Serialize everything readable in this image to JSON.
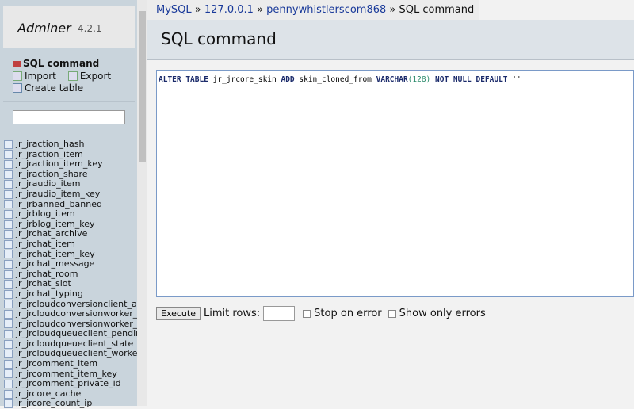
{
  "app": {
    "name": "Adminer",
    "version": "4.2.1"
  },
  "sidebar": {
    "menu": [
      {
        "label": "SQL command",
        "icon": "sql-icon"
      },
      {
        "label": "Import",
        "icon": "import-icon"
      },
      {
        "label": "Export",
        "icon": "export-icon"
      },
      {
        "label": "Create table",
        "icon": "create-table-icon"
      }
    ],
    "search_value": "",
    "tables": [
      "jr_jraction_hash",
      "jr_jraction_item",
      "jr_jraction_item_key",
      "jr_jraction_share",
      "jr_jraudio_item",
      "jr_jraudio_item_key",
      "jr_jrbanned_banned",
      "jr_jrblog_item",
      "jr_jrblog_item_key",
      "jr_jrchat_archive",
      "jr_jrchat_item",
      "jr_jrchat_item_key",
      "jr_jrchat_message",
      "jr_jrchat_room",
      "jr_jrchat_slot",
      "jr_jrchat_typing",
      "jr_jrcloudconversionclient_ac",
      "jr_jrcloudconversionworker_",
      "jr_jrcloudconversionworker_",
      "jr_jrcloudqueueclient_pendin",
      "jr_jrcloudqueueclient_state",
      "jr_jrcloudqueueclient_worker",
      "jr_jrcomment_item",
      "jr_jrcomment_item_key",
      "jr_jrcomment_private_id",
      "jr_jrcore_cache",
      "jr_jrcore_count_ip"
    ]
  },
  "breadcrumb": {
    "driver": "MySQL",
    "server": "127.0.0.1",
    "database": "pennywhistlerscom868",
    "sep": "»",
    "current": "SQL command"
  },
  "page_title": "SQL command",
  "sql": {
    "parts": [
      [
        "kw",
        "ALTER TABLE"
      ],
      [
        "",
        "jr_jrcore_skin"
      ],
      [
        "kw",
        "ADD"
      ],
      [
        "",
        "skin_cloned_from"
      ],
      [
        "kw",
        "VARCHAR"
      ],
      [
        "num",
        "(128)"
      ],
      [
        "kw",
        "NOT NULL DEFAULT"
      ],
      [
        "",
        "''"
      ]
    ]
  },
  "controls": {
    "execute": "Execute",
    "limit_label": "Limit rows:",
    "limit_value": "",
    "stop_on_error": "Stop on error",
    "show_only_errors": "Show only errors"
  }
}
